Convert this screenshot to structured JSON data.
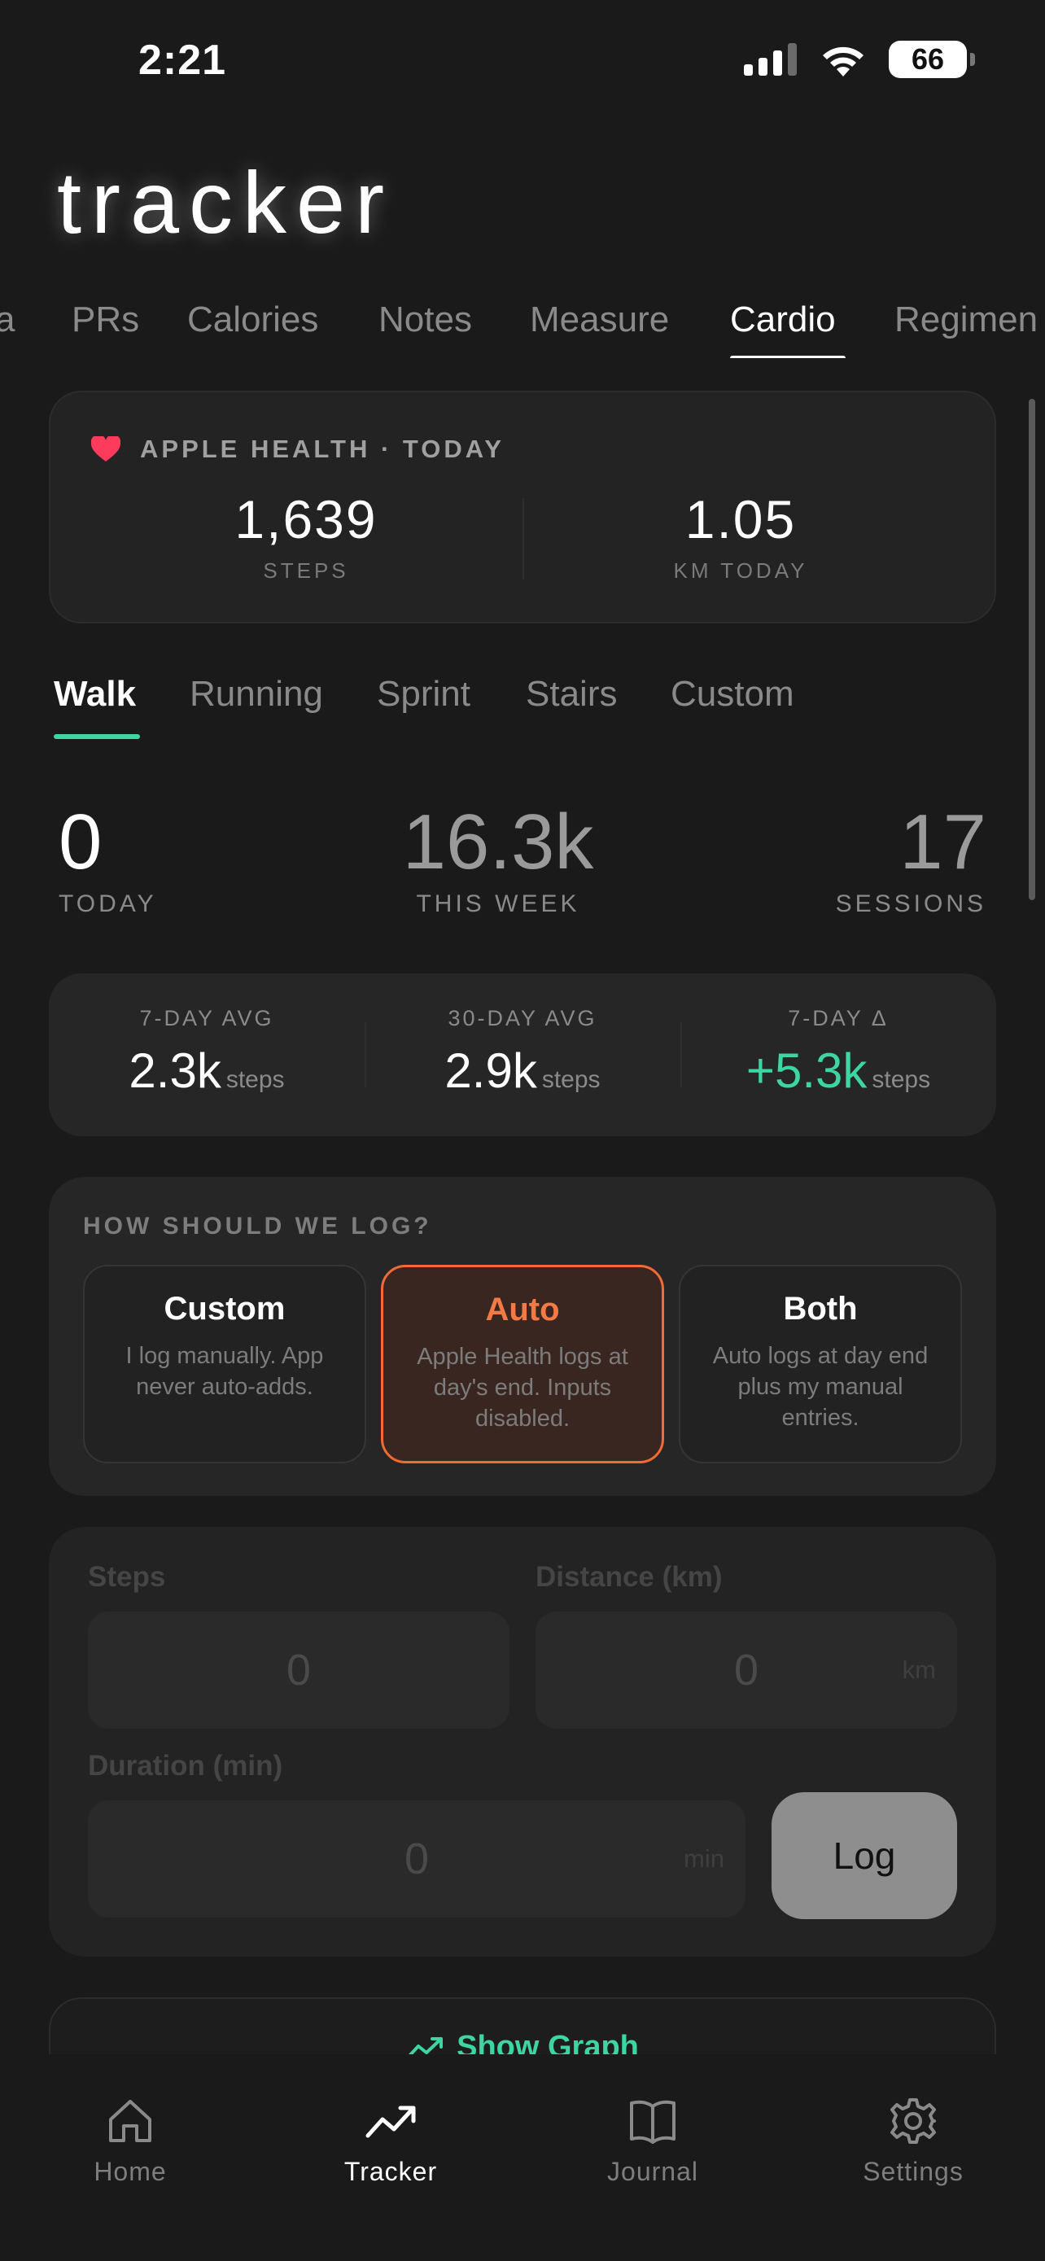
{
  "status_bar": {
    "time": "2:21",
    "battery": "66",
    "icons": [
      "signal-icon",
      "wifi-icon",
      "battery-icon"
    ]
  },
  "app": {
    "title": "tracker"
  },
  "top_tabs": [
    {
      "label": "a"
    },
    {
      "label": "PRs"
    },
    {
      "label": "Calories"
    },
    {
      "label": "Notes"
    },
    {
      "label": "Measure"
    },
    {
      "label": "Cardio",
      "active": true
    },
    {
      "label": "Regimen"
    }
  ],
  "health": {
    "header": "APPLE HEALTH · TODAY",
    "icon": "heart-icon",
    "steps": {
      "value": "1,639",
      "caption": "STEPS"
    },
    "distance": {
      "value": "1.05",
      "caption": "KM TODAY"
    }
  },
  "activity_tabs": [
    {
      "label": "Walk",
      "active": true
    },
    {
      "label": "Running"
    },
    {
      "label": "Sprint"
    },
    {
      "label": "Stairs"
    },
    {
      "label": "Custom"
    }
  ],
  "summary": {
    "today": {
      "value": "0",
      "caption": "TODAY"
    },
    "week": {
      "value": "16.3k",
      "caption": "THIS WEEK"
    },
    "sessions": {
      "value": "17",
      "caption": "SESSIONS"
    }
  },
  "averages": [
    {
      "label": "7-DAY AVG",
      "value": "2.3k",
      "unit": "steps"
    },
    {
      "label": "30-DAY AVG",
      "value": "2.9k",
      "unit": "steps"
    },
    {
      "label": "7-DAY Δ",
      "value": "+5.3k",
      "unit": "steps"
    }
  ],
  "log_mode": {
    "question": "HOW SHOULD WE LOG?",
    "options": [
      {
        "title": "Custom",
        "description": "I log manually. App never auto-adds."
      },
      {
        "title": "Auto",
        "description": "Apple Health logs at day's end. Inputs disabled.",
        "selected": true
      },
      {
        "title": "Both",
        "description": "Auto logs at day end plus my manual entries."
      }
    ]
  },
  "form": {
    "steps": {
      "label": "Steps",
      "placeholder": "0"
    },
    "distance": {
      "label": "Distance (km)",
      "placeholder": "0",
      "unit": "km"
    },
    "duration": {
      "label": "Duration (min)",
      "placeholder": "0",
      "unit": "min"
    },
    "log_button": "Log"
  },
  "graph": {
    "label": "Show Graph",
    "icon": "trend-icon"
  },
  "bottom_nav": [
    {
      "label": "Home",
      "icon": "home-icon"
    },
    {
      "label": "Tracker",
      "icon": "trend-icon",
      "active": true
    },
    {
      "label": "Journal",
      "icon": "book-icon"
    },
    {
      "label": "Settings",
      "icon": "gear-icon"
    }
  ],
  "colors": {
    "accent_green": "#3dd6a3",
    "accent_orange": "#f26b35",
    "heart": "#ff3b5c"
  }
}
